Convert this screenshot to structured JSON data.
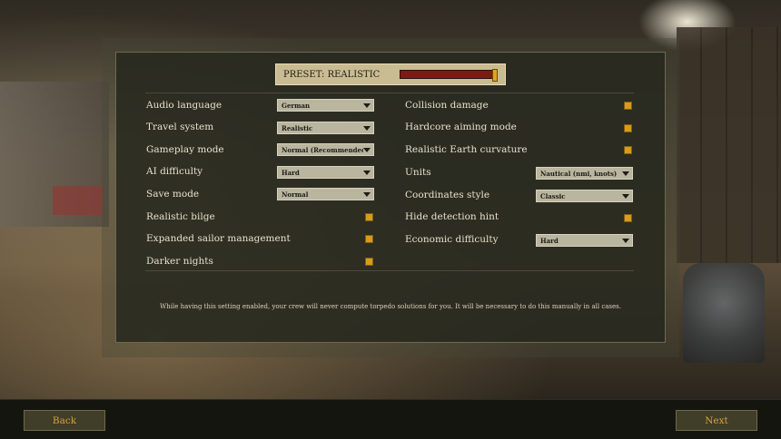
{
  "preset": {
    "label": "PRESET: REALISTIC",
    "level": 1.0
  },
  "left_settings": [
    {
      "label": "Audio language",
      "type": "dropdown",
      "value": "German"
    },
    {
      "label": "Travel system",
      "type": "dropdown",
      "value": "Realistic"
    },
    {
      "label": "Gameplay mode",
      "type": "dropdown",
      "value": "Normal (Recommended)"
    },
    {
      "label": "AI difficulty",
      "type": "dropdown",
      "value": "Hard"
    },
    {
      "label": "Save mode",
      "type": "dropdown",
      "value": "Normal"
    },
    {
      "label": "Realistic bilge",
      "type": "checkbox",
      "checked": true
    },
    {
      "label": "Expanded sailor management",
      "type": "checkbox",
      "checked": true
    },
    {
      "label": "Darker nights",
      "type": "checkbox",
      "checked": true
    }
  ],
  "right_settings": [
    {
      "label": "Collision damage",
      "type": "checkbox",
      "checked": true
    },
    {
      "label": "Hardcore aiming mode",
      "type": "checkbox",
      "checked": true
    },
    {
      "label": "Realistic Earth curvature",
      "type": "checkbox",
      "checked": true
    },
    {
      "label": "Units",
      "type": "dropdown",
      "value": "Nautical (nmi, knots)"
    },
    {
      "label": "Coordinates style",
      "type": "dropdown",
      "value": "Classic"
    },
    {
      "label": "Hide detection hint",
      "type": "checkbox",
      "checked": true
    },
    {
      "label": "Economic difficulty",
      "type": "dropdown",
      "value": "Hard"
    }
  ],
  "hint": "While having this setting enabled, your crew will never compute torpedo solutions for you. It will be necessary to do this manually in all cases.",
  "buttons": {
    "back": "Back",
    "next": "Next"
  },
  "colors": {
    "checkbox": "#d99b1c",
    "button_text": "#d9a23a",
    "preset_bar": "#7a1c16"
  }
}
